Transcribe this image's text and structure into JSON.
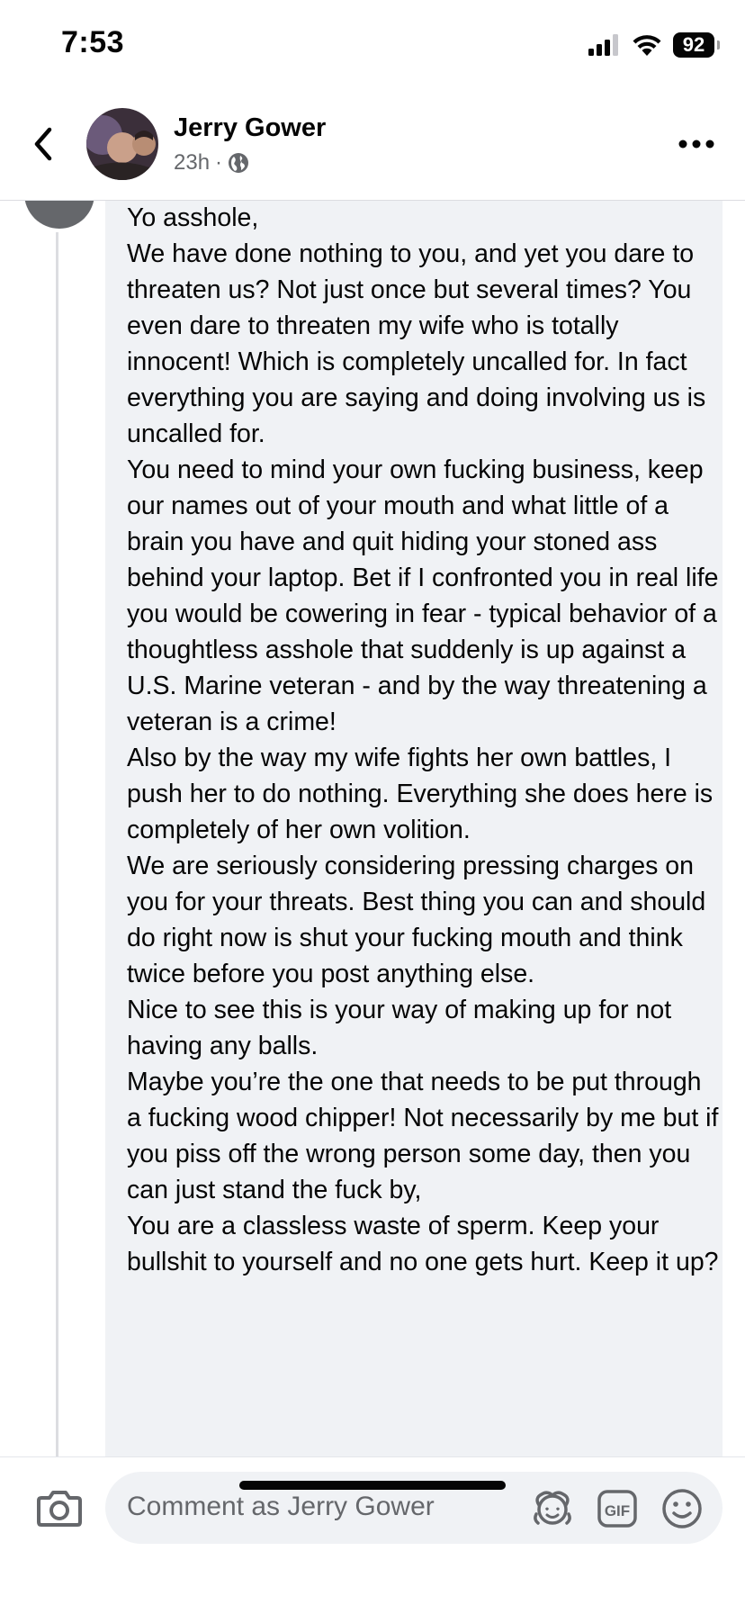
{
  "status_bar": {
    "time": "7:53",
    "battery": "92",
    "icons": [
      "signal-icon",
      "wifi-icon",
      "battery-icon"
    ]
  },
  "header": {
    "author_name": "Jerry Gower",
    "time_ago": "23h",
    "separator": "·",
    "icons": [
      "back-arrow-icon",
      "globe-icon",
      "more-dots-icon"
    ]
  },
  "comment": {
    "lines": [
      "Yo asshole,",
      "We have done nothing to you, and yet you dare to threaten us? Not just once but several times? You even dare to threaten my wife who is totally innocent! Which is completely uncalled for. In fact everything you are saying and doing involving us is uncalled for.",
      "You need to mind your own fucking business, keep our names out of your mouth and what little of a brain you have and quit hiding your stoned ass behind your laptop. Bet if I confronted you in real life you would be cowering in fear - typical behavior of a thoughtless asshole that suddenly is up against a U.S. Marine veteran - and by the way threatening a veteran is a crime!",
      "Also by the way my wife fights her own battles, I push her to do nothing. Everything she does here is completely of her own volition.",
      "We are seriously considering pressing charges on you for your threats. Best thing you can and should do right now is shut your fucking mouth and think twice before you post anything else.",
      "Nice to see this is your way of making up for not having any balls.",
      "Maybe you’re the one that needs to be put through a fucking wood chipper! Not necessarily by me but if you piss off the wrong person some day, then you can just stand the fuck by,",
      "You are a classless waste of sperm. Keep your bullshit to yourself and no one gets hurt. Keep it up?"
    ]
  },
  "composer": {
    "placeholder": "Comment as Jerry Gower",
    "gif_label": "GIF",
    "icons": [
      "camera-icon",
      "avatar-sticker-icon",
      "gif-icon",
      "emoji-icon"
    ]
  }
}
